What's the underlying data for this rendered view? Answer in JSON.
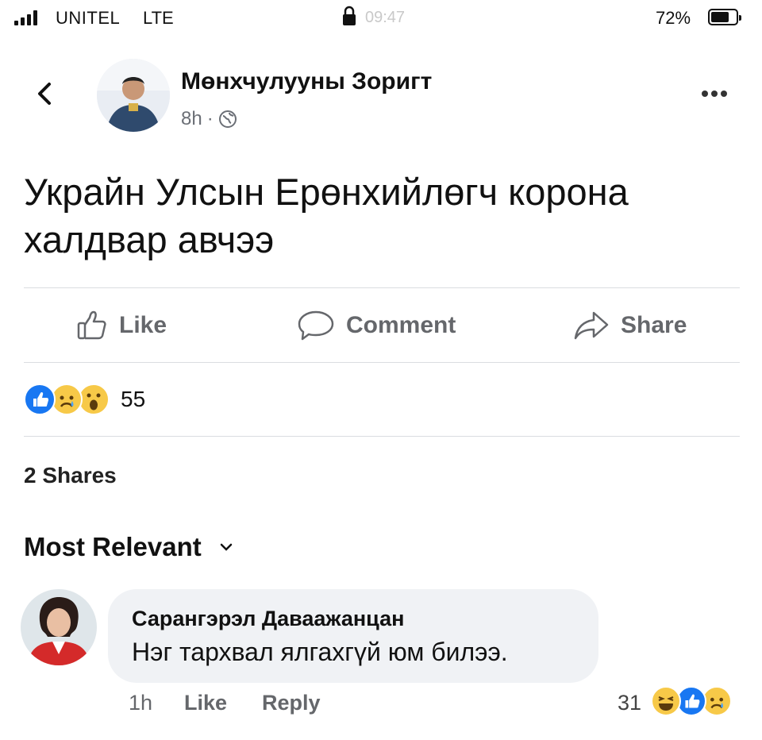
{
  "status_bar": {
    "carrier": "UNITEL",
    "network": "LTE",
    "time": "09:47",
    "battery_percent": "72%",
    "battery_level": 0.72,
    "signal_icon": "signal-bars-icon",
    "lock_icon": "orientation-lock-icon",
    "battery_icon": "battery-icon"
  },
  "post": {
    "author": "Мөнхчулууны Зоригт",
    "time_ago": "8h",
    "separator": "·",
    "privacy_icon": "globe-icon",
    "text": "Украйн Улсын Ерөнхийлөгч корона халдвар авчээ",
    "actions": {
      "like": "Like",
      "comment": "Comment",
      "share": "Share"
    },
    "reactions": {
      "icons": [
        "like-reaction-icon",
        "sad-reaction-icon",
        "wow-reaction-icon"
      ],
      "count": "55"
    },
    "shares": "2 Shares"
  },
  "comments_sort": {
    "label": "Most Relevant",
    "icon": "chevron-down-icon"
  },
  "comments": [
    {
      "author": "Сарангэрэл Даваажанцан",
      "text": "Нэг тархвал ялгахгүй юм билээ.",
      "time_ago": "1h",
      "like": "Like",
      "reply": "Reply",
      "reaction_count": "31",
      "reaction_icons": [
        "haha-reaction-icon",
        "like-reaction-icon",
        "sad-reaction-icon"
      ]
    }
  ],
  "colors": {
    "facebook_blue": "#1877f2",
    "muted_text": "#65676b",
    "bubble_bg": "#f0f2f5",
    "divider": "#dadde1",
    "reaction_yellow": "#f7c948"
  }
}
